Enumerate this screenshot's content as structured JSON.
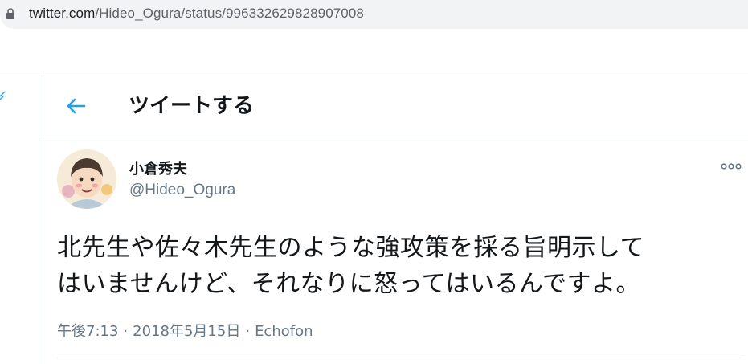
{
  "browser": {
    "url_host": "twitter.com",
    "url_path": "/Hideo_Ogura/status/996332629828907008"
  },
  "header": {
    "title": "ツイートする",
    "back_icon": "arrow-left-icon"
  },
  "tweet": {
    "display_name": "小倉秀夫",
    "handle": "@Hideo_Ogura",
    "text_line1": "北先生や佐々木先生のような強攻策を採る旨明示して",
    "text_line2": "はいませんけど、それなりに怒ってはいるんですよ。",
    "time": "午後7:13",
    "date": "2018年5月15日",
    "client": "Echofon",
    "separator": "·"
  },
  "colors": {
    "accent": "#1da1f2",
    "text": "#14171a",
    "secondary": "#657786"
  }
}
